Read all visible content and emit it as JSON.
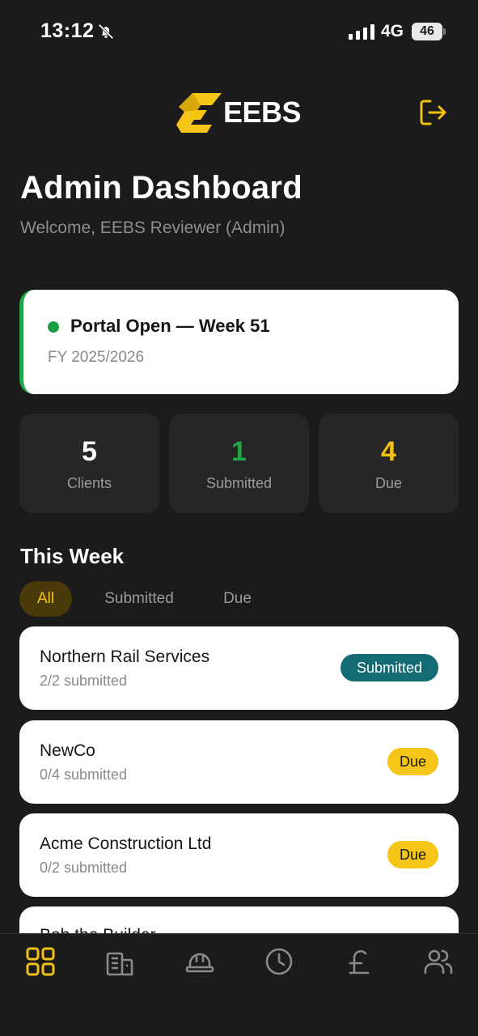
{
  "status_bar": {
    "time": "13:12",
    "network": "4G",
    "battery": "46"
  },
  "header": {
    "brand_name": "EEBS",
    "title": "Admin Dashboard",
    "welcome": "Welcome, EEBS Reviewer (Admin)"
  },
  "portal": {
    "status": "Portal Open — Week 51",
    "fiscal_year": "FY 2025/2026",
    "status_color": "#1f9d45"
  },
  "stats": [
    {
      "value": "5",
      "label": "Clients",
      "color": "#ffffff"
    },
    {
      "value": "1",
      "label": "Submitted",
      "color": "#22a447"
    },
    {
      "value": "4",
      "label": "Due",
      "color": "#f2c117"
    }
  ],
  "week_section": {
    "title": "This Week",
    "filters": [
      {
        "label": "All",
        "active": true
      },
      {
        "label": "Submitted",
        "active": false
      },
      {
        "label": "Due",
        "active": false
      }
    ]
  },
  "clients": [
    {
      "name": "Northern Rail Services",
      "progress": "2/2 submitted",
      "badge": "Submitted",
      "badge_type": "submitted"
    },
    {
      "name": "NewCo",
      "progress": "0/4 submitted",
      "badge": "Due",
      "badge_type": "due"
    },
    {
      "name": "Acme Construction Ltd",
      "progress": "0/2 submitted",
      "badge": "Due",
      "badge_type": "due"
    },
    {
      "name": "Bob the Builder",
      "progress": "",
      "badge": "",
      "badge_type": ""
    }
  ],
  "bottom_nav": [
    {
      "icon": "dashboard-icon",
      "active": true
    },
    {
      "icon": "building-icon",
      "active": false
    },
    {
      "icon": "hard-hat-icon",
      "active": false
    },
    {
      "icon": "clock-icon",
      "active": false
    },
    {
      "icon": "pound-icon",
      "active": false
    },
    {
      "icon": "users-icon",
      "active": false
    }
  ],
  "colors": {
    "accent": "#f2c117",
    "background": "#1b1b1b",
    "card": "#262626",
    "submitted_badge": "#146b73",
    "due_badge": "#f5c518"
  }
}
